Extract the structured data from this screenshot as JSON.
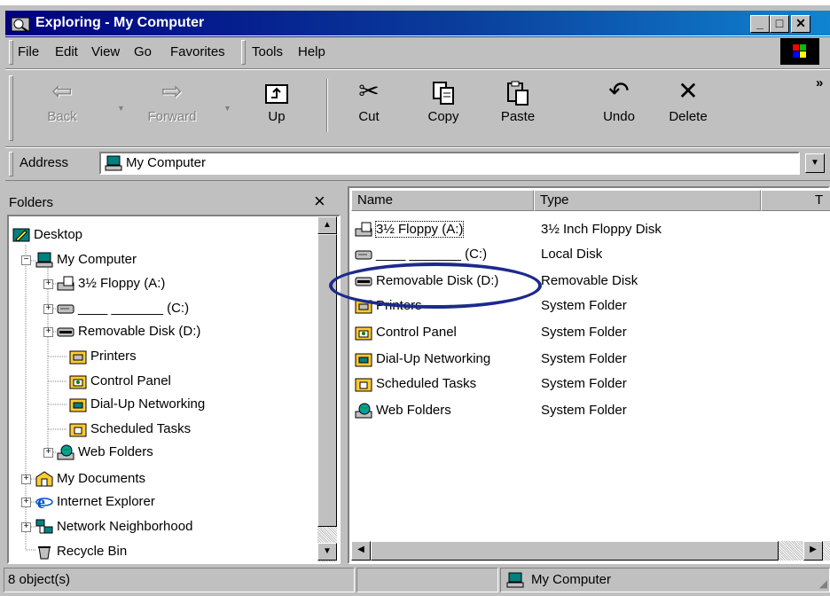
{
  "title": "Exploring - My Computer",
  "menu": [
    "File",
    "Edit",
    "View",
    "Go",
    "Favorites",
    "Tools",
    "Help"
  ],
  "toolbar": [
    {
      "label": "Back",
      "icon": "back-arrow-icon",
      "glyph": "⇦",
      "disabled": true
    },
    {
      "label": "Forward",
      "icon": "forward-arrow-icon",
      "glyph": "⇨",
      "disabled": true
    },
    {
      "label": "Up",
      "icon": "up-folder-icon",
      "glyph": "⮤",
      "disabled": false
    },
    {
      "label": "Cut",
      "icon": "scissors-icon",
      "glyph": "✂",
      "disabled": false
    },
    {
      "label": "Copy",
      "icon": "copy-icon",
      "glyph": "⎘",
      "disabled": false
    },
    {
      "label": "Paste",
      "icon": "paste-icon",
      "glyph": "📋",
      "disabled": false
    },
    {
      "label": "Undo",
      "icon": "undo-icon",
      "glyph": "↶",
      "disabled": false
    },
    {
      "label": "Delete",
      "icon": "delete-x-icon",
      "glyph": "✕",
      "disabled": false
    }
  ],
  "toolbar_more": "»",
  "address": {
    "label": "Address",
    "value": "My Computer"
  },
  "folders": {
    "header": "Folders",
    "close": "×",
    "items": [
      {
        "label": "Desktop",
        "icon": "desktop-icon"
      },
      {
        "label": "My Computer",
        "icon": "computer-icon"
      },
      {
        "label": "3½ Floppy (A:)",
        "icon": "floppy-drive-icon"
      },
      {
        "label": "____ _______ (C:)",
        "icon": "hard-disk-icon"
      },
      {
        "label": "Removable Disk (D:)",
        "icon": "removable-disk-icon"
      },
      {
        "label": "Printers",
        "icon": "printers-folder-icon"
      },
      {
        "label": "Control Panel",
        "icon": "control-panel-icon"
      },
      {
        "label": "Dial-Up Networking",
        "icon": "dialup-networking-icon"
      },
      {
        "label": "Scheduled Tasks",
        "icon": "scheduled-tasks-icon"
      },
      {
        "label": "Web Folders",
        "icon": "web-folders-icon"
      },
      {
        "label": "My Documents",
        "icon": "my-documents-icon"
      },
      {
        "label": "Internet Explorer",
        "icon": "internet-explorer-icon"
      },
      {
        "label": "Network Neighborhood",
        "icon": "network-neighborhood-icon"
      },
      {
        "label": "Recycle Bin",
        "icon": "recycle-bin-icon"
      }
    ]
  },
  "list": {
    "columns": [
      "Name",
      "Type",
      "T"
    ],
    "rows": [
      {
        "name": "3½ Floppy (A:)",
        "type": "3½ Inch Floppy Disk",
        "icon": "floppy-drive-icon"
      },
      {
        "name": "____ _______ (C:)",
        "type": "Local Disk",
        "icon": "hard-disk-icon"
      },
      {
        "name": "Removable Disk (D:)",
        "type": "Removable Disk",
        "icon": "removable-disk-icon"
      },
      {
        "name": "Printers",
        "type": "System Folder",
        "icon": "printers-folder-icon"
      },
      {
        "name": "Control Panel",
        "type": "System Folder",
        "icon": "control-panel-icon"
      },
      {
        "name": "Dial-Up Networking",
        "type": "System Folder",
        "icon": "dialup-networking-icon"
      },
      {
        "name": "Scheduled Tasks",
        "type": "System Folder",
        "icon": "scheduled-tasks-icon"
      },
      {
        "name": "Web Folders",
        "type": "System Folder",
        "icon": "web-folders-icon"
      }
    ]
  },
  "status": {
    "count": "8 object(s)",
    "location": "My Computer"
  },
  "colors": {
    "titlebar_start": "#000080",
    "titlebar_end": "#1084d0",
    "face": "#c0c0c0",
    "highlight_ring": "#1c2a8c"
  }
}
